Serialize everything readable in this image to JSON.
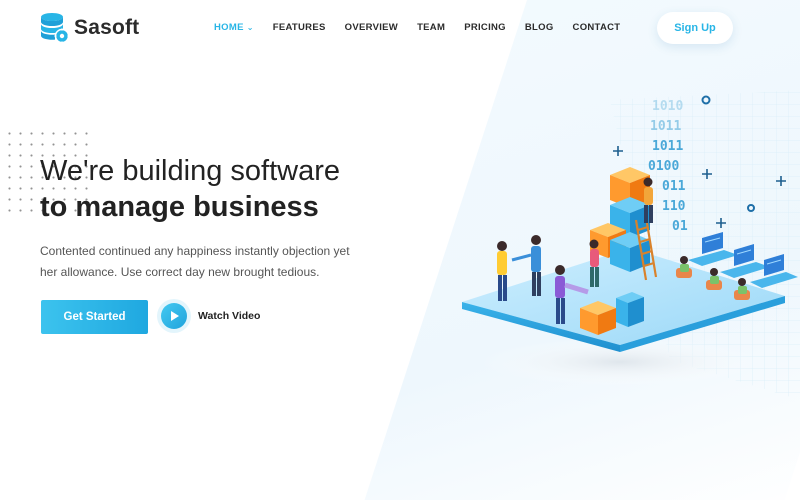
{
  "brand": {
    "name": "Sasoft",
    "accent_color": "#28b5e6",
    "icon": "database-gear-icon"
  },
  "nav": {
    "items": [
      {
        "label": "HOME",
        "active": true,
        "has_dropdown": true
      },
      {
        "label": "FEATURES"
      },
      {
        "label": "OVERVIEW"
      },
      {
        "label": "TEAM"
      },
      {
        "label": "PRICING"
      },
      {
        "label": "BLOG"
      },
      {
        "label": "CONTACT"
      }
    ],
    "caret": "⌄"
  },
  "header": {
    "signup_label": "Sign Up"
  },
  "hero": {
    "title_line1": "We're building software",
    "title_line2": "to manage business",
    "description": "Contented continued any happiness instantly objection yet her allowance. Use correct day new brought tedious.",
    "primary_cta": "Get Started",
    "video_cta": "Watch Video"
  },
  "illustration": {
    "binary_rows": [
      "1010",
      "1011",
      "1011",
      "0100",
      "011",
      "110",
      "01"
    ]
  },
  "colors": {
    "cta_start": "#3cc3ee",
    "cta_end": "#1fa8e0",
    "text_dark": "#222222",
    "text_muted": "#555555"
  }
}
